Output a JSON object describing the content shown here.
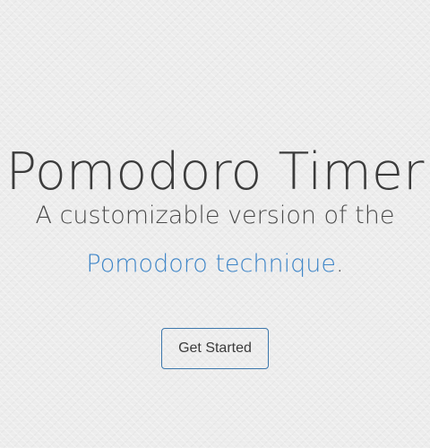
{
  "hero": {
    "title": "Pomodoro Timer",
    "subtitle_line1": "A customizable version of the",
    "subtitle_link": "Pomodoro technique",
    "subtitle_period": ".",
    "cta_label": "Get Started"
  },
  "colors": {
    "background": "#ececec",
    "text": "#3f3f3f",
    "link": "#3f86c8",
    "button_border": "#3c77ac"
  }
}
